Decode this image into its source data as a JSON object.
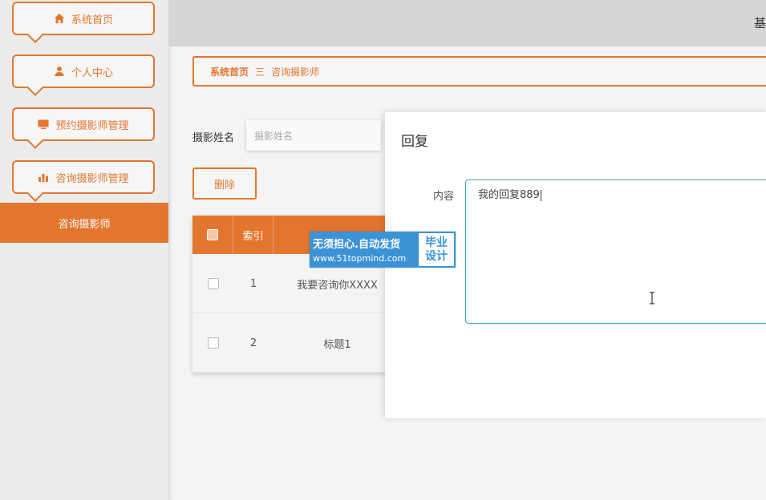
{
  "sidebar": {
    "menu": [
      {
        "label": "系统首页",
        "icon": "home-icon"
      },
      {
        "label": "个人中心",
        "icon": "user-icon"
      },
      {
        "label": "预约摄影师管理",
        "icon": "monitor-icon"
      },
      {
        "label": "咨询摄影师管理",
        "icon": "bar-chart-icon"
      }
    ],
    "active_sub_item": "咨询摄影师"
  },
  "header": {
    "right_text": "基"
  },
  "breadcrumb": {
    "home": "系统首页",
    "separator": "三",
    "current": "咨询摄影师"
  },
  "search": {
    "label": "摄影姓名",
    "placeholder": "摄影姓名"
  },
  "toolbar": {
    "delete_label": "删除"
  },
  "table": {
    "columns": [
      "",
      "索引",
      ""
    ],
    "rows": [
      {
        "index": "1",
        "title": "我要咨询你XXXX"
      },
      {
        "index": "2",
        "title": "标题1"
      }
    ]
  },
  "watermark": {
    "line1": "无须担心.自动发货",
    "line2": "www.51topmind.com",
    "badge_line1": "毕业",
    "badge_line2": "设计"
  },
  "dialog": {
    "title": "回复",
    "field_label": "内容",
    "content_value": "我的回复889"
  },
  "colors": {
    "accent": "#e3762f",
    "focus_border": "#3aa6b9",
    "watermark_blue": "#3b93d6"
  }
}
